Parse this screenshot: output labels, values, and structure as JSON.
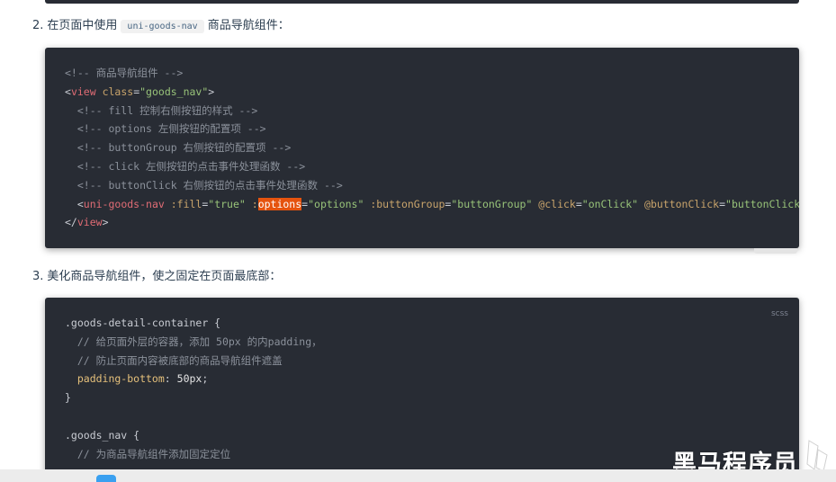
{
  "step2": {
    "number": "2.",
    "text_before": "在页面中使用",
    "inline_code": "uni-goods-nav",
    "text_after": "商品导航组件："
  },
  "code1": {
    "lines": [
      {
        "id": "l1",
        "tokens": [
          {
            "t": "<!-- 商品导航组件 -->",
            "c": "comment"
          }
        ]
      },
      {
        "id": "l2",
        "tokens": [
          {
            "t": "<",
            "c": "punc"
          },
          {
            "t": "view",
            "c": "tag"
          },
          {
            "t": " class",
            "c": "attr"
          },
          {
            "t": "=",
            "c": "punc"
          },
          {
            "t": "\"goods_nav\"",
            "c": "str"
          },
          {
            "t": ">",
            "c": "punc"
          }
        ]
      },
      {
        "id": "l3",
        "tokens": [
          {
            "t": "  <!-- fill 控制右侧按钮的样式 -->",
            "c": "comment"
          }
        ]
      },
      {
        "id": "l4",
        "tokens": [
          {
            "t": "  <!-- options 左侧按钮的配置项 -->",
            "c": "comment"
          }
        ]
      },
      {
        "id": "l5",
        "tokens": [
          {
            "t": "  <!-- buttonGroup 右侧按钮的配置项 -->",
            "c": "comment"
          }
        ]
      },
      {
        "id": "l6",
        "tokens": [
          {
            "t": "  <!-- click 左侧按钮的点击事件处理函数 -->",
            "c": "comment"
          }
        ]
      },
      {
        "id": "l7",
        "tokens": [
          {
            "t": "  <!-- buttonClick 右侧按钮的点击事件处理函数 -->",
            "c": "comment"
          }
        ]
      },
      {
        "id": "l8",
        "tokens": [
          {
            "t": "  <",
            "c": "punc"
          },
          {
            "t": "uni-goods-nav",
            "c": "tag"
          },
          {
            "t": " :fill",
            "c": "attr"
          },
          {
            "t": "=",
            "c": "punc"
          },
          {
            "t": "\"true\"",
            "c": "str"
          },
          {
            "t": " :",
            "c": "attr"
          },
          {
            "t": "options",
            "c": "attr",
            "hl": true
          },
          {
            "t": "=",
            "c": "punc"
          },
          {
            "t": "\"options\"",
            "c": "str"
          },
          {
            "t": " :buttonGroup",
            "c": "attr"
          },
          {
            "t": "=",
            "c": "punc"
          },
          {
            "t": "\"buttonGroup\"",
            "c": "str"
          },
          {
            "t": " @click",
            "c": "attr"
          },
          {
            "t": "=",
            "c": "punc"
          },
          {
            "t": "\"onClick\"",
            "c": "str"
          },
          {
            "t": " @buttonClick",
            "c": "attr"
          },
          {
            "t": "=",
            "c": "punc"
          },
          {
            "t": "\"buttonClick\"",
            "c": "str"
          }
        ]
      },
      {
        "id": "l9",
        "tokens": [
          {
            "t": "</",
            "c": "punc"
          },
          {
            "t": "view",
            "c": "tag"
          },
          {
            "t": ">",
            "c": "punc"
          }
        ]
      }
    ]
  },
  "step3": {
    "number": "3.",
    "text": "美化商品导航组件，使之固定在页面最底部："
  },
  "code2": {
    "language_label": "scss",
    "lines": [
      {
        "id": "m1",
        "tokens": [
          {
            "t": ".goods-detail-container {",
            "c": "sel"
          }
        ]
      },
      {
        "id": "m2",
        "tokens": [
          {
            "t": "  // 给页面外层的容器，添加 50px 的内padding，",
            "c": "comment"
          }
        ]
      },
      {
        "id": "m3",
        "tokens": [
          {
            "t": "  // 防止页面内容被底部的商品导航组件遮盖",
            "c": "comment"
          }
        ]
      },
      {
        "id": "m4",
        "tokens": [
          {
            "t": "  padding-bottom",
            "c": "prop"
          },
          {
            "t": ": ",
            "c": "punc"
          },
          {
            "t": "50px",
            "c": "num"
          },
          {
            "t": ";",
            "c": "punc"
          }
        ]
      },
      {
        "id": "m5",
        "tokens": [
          {
            "t": "}",
            "c": "sel"
          }
        ]
      },
      {
        "id": "m6",
        "tokens": [
          {
            "t": "",
            "c": "punc"
          }
        ]
      },
      {
        "id": "m7",
        "tokens": [
          {
            "t": ".goods_nav {",
            "c": "sel"
          }
        ]
      },
      {
        "id": "m8",
        "tokens": [
          {
            "t": "  // 为商品导航组件添加固定定位",
            "c": "comment"
          }
        ]
      }
    ]
  },
  "watermark": {
    "text": "黑马程序员"
  }
}
